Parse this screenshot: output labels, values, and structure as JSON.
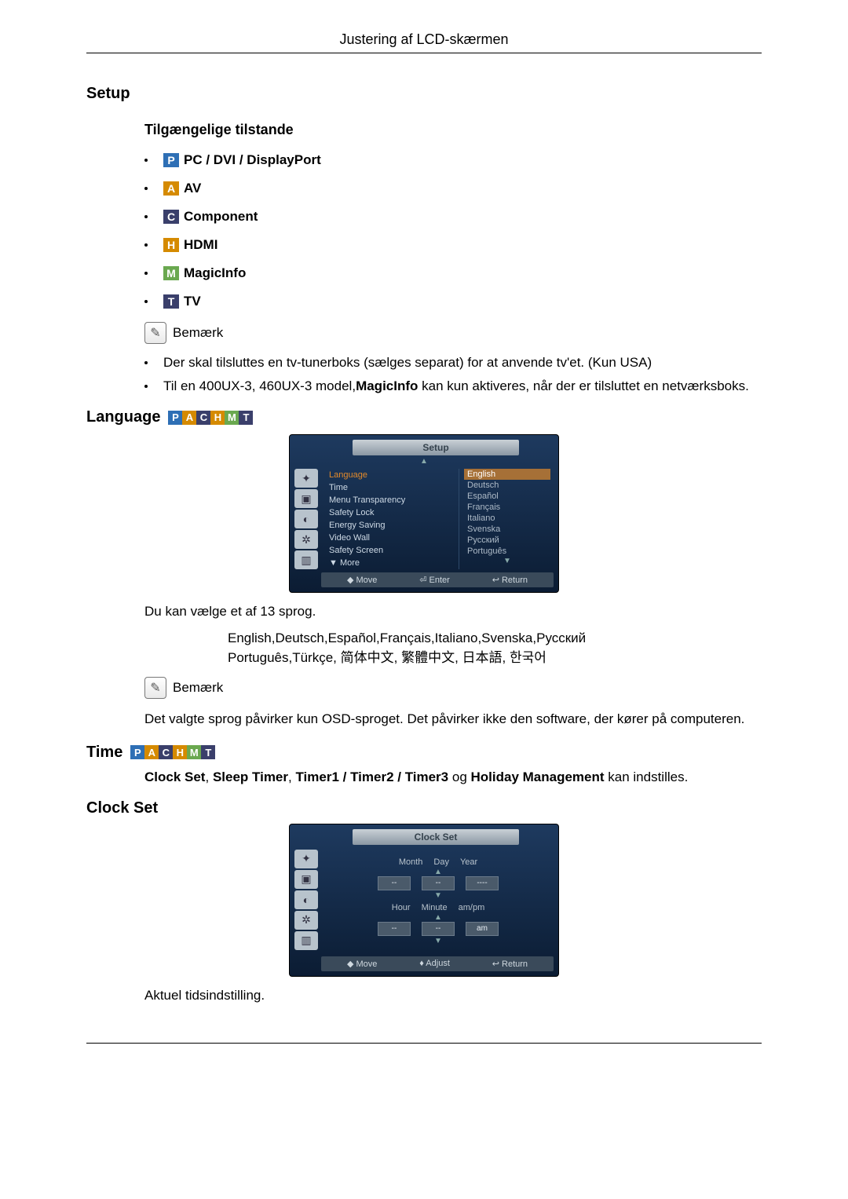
{
  "headerTitle": "Justering af LCD-skærmen",
  "setupHeading": "Setup",
  "modesHeading": "Tilgængelige tilstande",
  "modes": [
    {
      "letter": "P",
      "bg": "badge-p",
      "label": "PC / DVI / DisplayPort"
    },
    {
      "letter": "A",
      "bg": "badge-a",
      "label": "AV"
    },
    {
      "letter": "C",
      "bg": "badge-c",
      "label": "Component"
    },
    {
      "letter": "H",
      "bg": "badge-h",
      "label": "HDMI"
    },
    {
      "letter": "M",
      "bg": "badge-m",
      "label": "MagicInfo"
    },
    {
      "letter": "T",
      "bg": "badge-t",
      "label": "TV"
    }
  ],
  "noteLabel": "Bemærk",
  "note1": "Der skal tilsluttes en tv-tunerboks (sælges separat) for at anvende tv'et. (Kun USA)",
  "note2_a": "Til en 400UX-3, 460UX-3 model,",
  "note2_b": "MagicInfo",
  "note2_c": " kan kun aktiveres, når der er tilsluttet en netværksboks.",
  "languageHeading": "Language",
  "osdSetup": {
    "title": "Setup",
    "menu": [
      "Language",
      "Time",
      "Menu Transparency",
      "Safety Lock",
      "Energy Saving",
      "Video Wall",
      "Safety Screen",
      "▼ More"
    ],
    "langlist": [
      "English",
      "Deutsch",
      "Español",
      "Français",
      "Italiano",
      "Svenska",
      "Русский",
      "Português"
    ],
    "footer": [
      "◆ Move",
      "⏎ Enter",
      "↩ Return"
    ]
  },
  "langIntro": "Du kan vælge et af 13 sprog.",
  "langList": "English,Deutsch,Español,Français,Italiano,Svenska,Русский Português,Türkçe, 简体中文,  繁體中文, 日本語, 한국어",
  "langNote": "Det valgte sprog påvirker kun OSD-sproget. Det påvirker ikke den software, der kører på computeren.",
  "timeHeading": "Time",
  "timeText_parts": {
    "a": "Clock Set",
    "b": ", ",
    "c": "Sleep Timer",
    "d": ", ",
    "e": "Timer1 / Timer2 / Timer3",
    "f": " og ",
    "g": "Holiday Management",
    "h": " kan indstilles."
  },
  "clockSetHeading": "Clock Set",
  "osdClock": {
    "title": "Clock Set",
    "row1Labels": [
      "Month",
      "Day",
      "Year"
    ],
    "row1Values": [
      "--",
      "--",
      "----"
    ],
    "row2Labels": [
      "Hour",
      "Minute",
      "am/pm"
    ],
    "row2Values": [
      "--",
      "--",
      "am"
    ],
    "footer": [
      "◆ Move",
      "♦ Adjust",
      "↩ Return"
    ]
  },
  "clockText": "Aktuel tidsindstilling."
}
